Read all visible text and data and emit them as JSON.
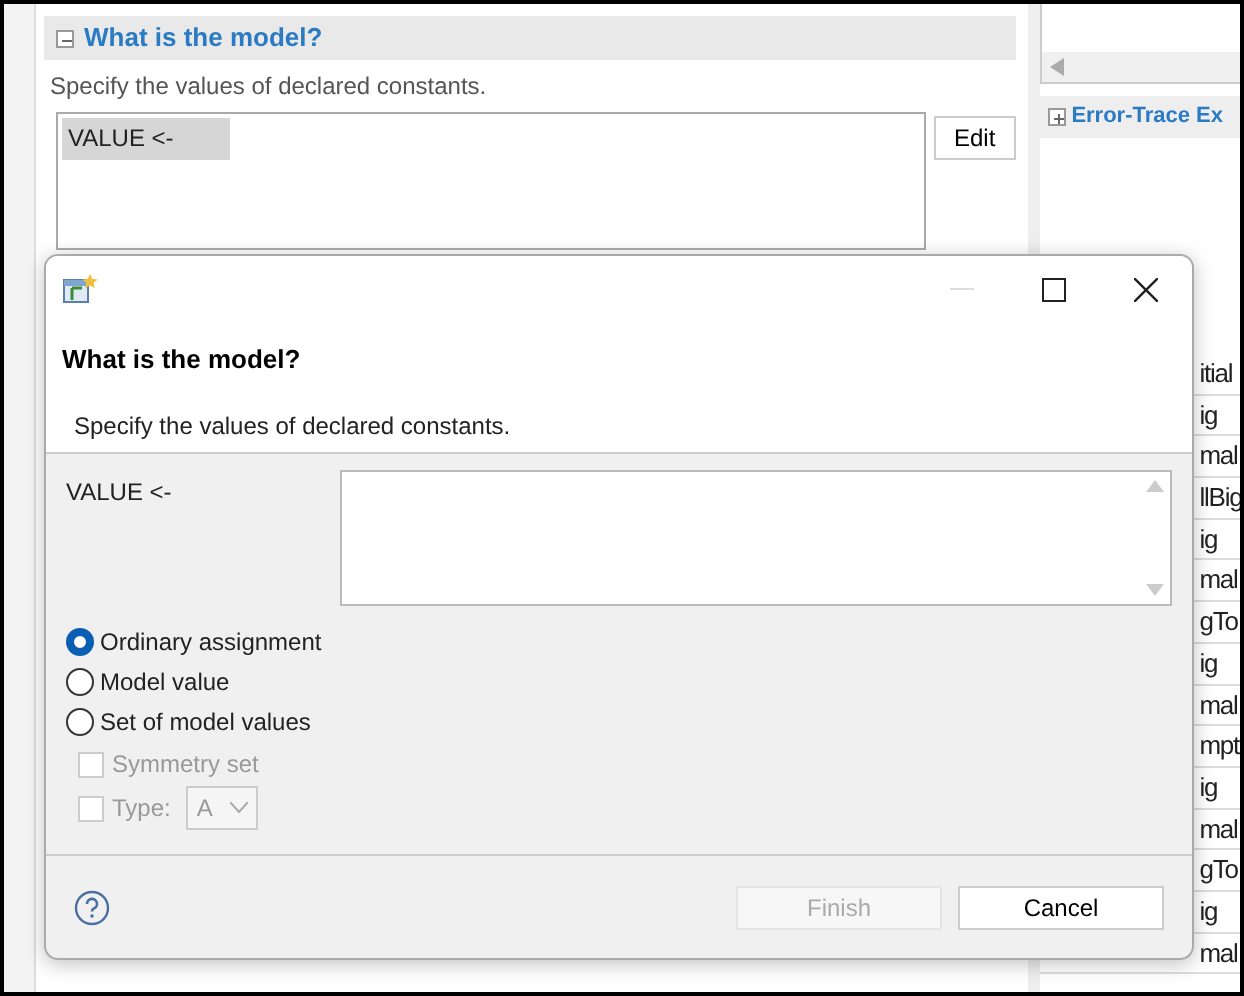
{
  "editor": {
    "section": {
      "title": "What is the model?",
      "expanded": true,
      "description": "Specify the values of declared constants.",
      "list_items": [
        {
          "text": "VALUE <-",
          "selected": true
        }
      ],
      "edit_button": "Edit"
    }
  },
  "right_panel": {
    "section": {
      "title": "Error-Trace Ex",
      "expanded": false
    },
    "column_texts": [
      "itial",
      "ig",
      "mal",
      "llBig",
      "ig",
      "mal",
      "gTo",
      "ig",
      "mal",
      "mpt",
      "ig",
      "mal",
      "gTo",
      "ig",
      "mal"
    ]
  },
  "dialog": {
    "heading": "What is the model?",
    "description": "Specify the values of declared constants.",
    "field_label": "VALUE <-",
    "options": [
      {
        "label": "Ordinary assignment",
        "selected": true
      },
      {
        "label": "Model value",
        "selected": false
      },
      {
        "label": "Set of model values",
        "selected": false
      }
    ],
    "checkboxes": [
      {
        "kind": "plain",
        "label": "Symmetry set",
        "checked": false,
        "disabled": true
      },
      {
        "kind": "select",
        "label": "Type:",
        "checked": false,
        "disabled": true,
        "value": "A"
      }
    ],
    "buttons": [
      {
        "label": "Finish",
        "disabled": true
      },
      {
        "label": "Cancel",
        "disabled": false
      }
    ]
  }
}
